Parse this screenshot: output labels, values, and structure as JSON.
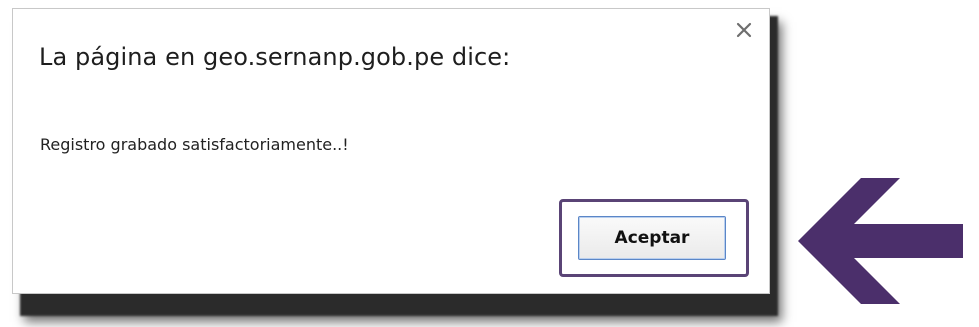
{
  "dialog": {
    "title": "La página en geo.sernanp.gob.pe dice:",
    "message": "Registro grabado satisfactoriamente..!",
    "close_icon": "close-icon",
    "accept_label": "Aceptar"
  },
  "annotation": {
    "arrow_icon": "left-arrow-icon",
    "accent_color": "#4b2f6b"
  }
}
